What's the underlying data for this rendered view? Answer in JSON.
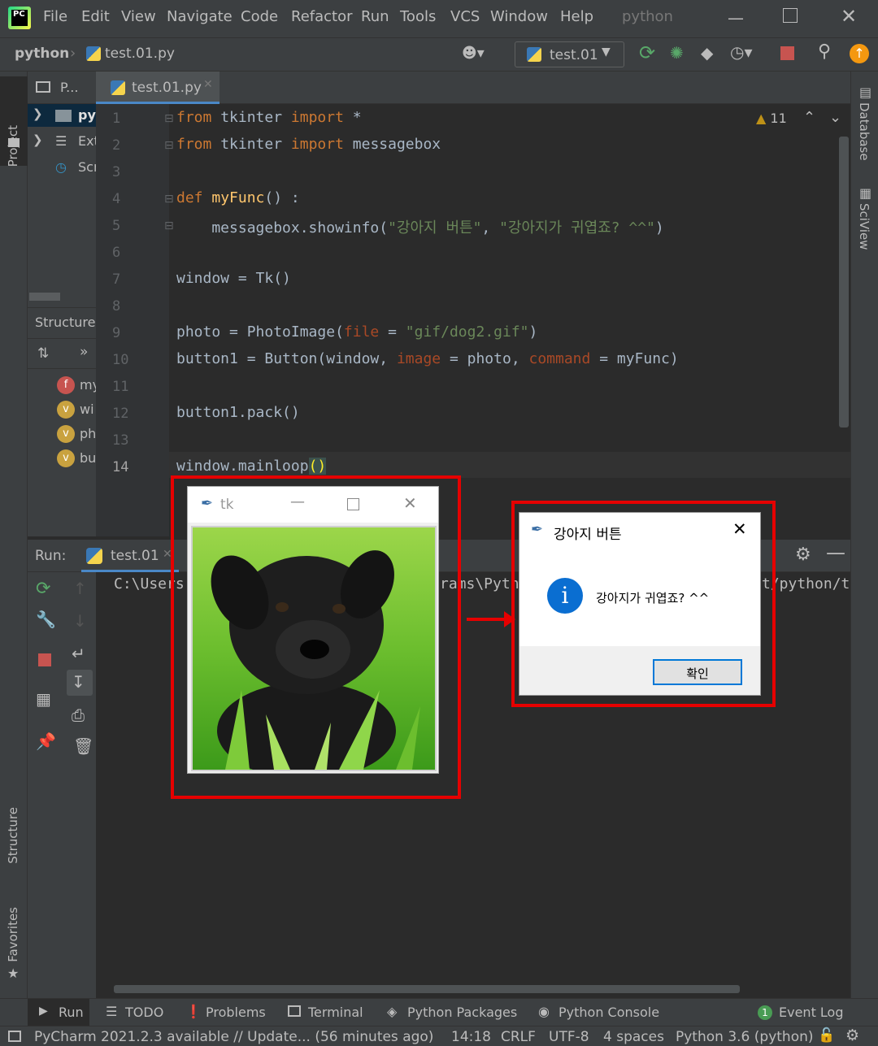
{
  "menubar": {
    "items": [
      "File",
      "Edit",
      "View",
      "Navigate",
      "Code",
      "Refactor",
      "Run",
      "Tools",
      "VCS",
      "Window",
      "Help"
    ],
    "project_title": "python"
  },
  "navbar": {
    "breadcrumb_project": "python",
    "breadcrumb_file": "test.01.py",
    "run_config": "test.01"
  },
  "tool_stripes": {
    "left_top": "Project",
    "left_structure": "Structure",
    "left_favorites": "Favorites",
    "right_database": "Database",
    "right_sciview": "SciView"
  },
  "project_panel": {
    "header": "P...",
    "items": [
      "py",
      "Ext",
      "Scr"
    ]
  },
  "structure_panel": {
    "title": "Structure",
    "items": [
      {
        "badge": "f",
        "label": "my"
      },
      {
        "badge": "v",
        "label": "wi"
      },
      {
        "badge": "v",
        "label": "ph"
      },
      {
        "badge": "v",
        "label": "bu"
      }
    ]
  },
  "editor": {
    "tab_label": "test.01.py",
    "warnings_count": "11",
    "line_numbers": [
      "1",
      "2",
      "3",
      "4",
      "5",
      "6",
      "7",
      "8",
      "9",
      "10",
      "11",
      "12",
      "13",
      "14"
    ],
    "lines": [
      "from tkinter import *",
      "from tkinter import messagebox",
      "",
      "def myFunc() :",
      "    messagebox.showinfo(\"강아지 버튼\", \"강아지가 귀엽죠? ^^\")",
      "",
      "window = Tk()",
      "",
      "photo = PhotoImage(file = \"gif/dog2.gif\")",
      "button1 = Button(window, image = photo, command = myFunc)",
      "",
      "button1.pack()",
      "",
      "window.mainloop()"
    ]
  },
  "run_panel": {
    "label": "Run:",
    "tab_label": "test.01",
    "console_left": "C:\\Users",
    "console_mid": "rams\\Pyth",
    "console_right": "t/python/t"
  },
  "tk_window": {
    "title": "tk"
  },
  "dialog": {
    "title": "강아지 버튼",
    "message": "강아지가 귀엽죠? ^^",
    "ok_label": "확인"
  },
  "bottom_tabs": [
    "Run",
    "TODO",
    "Problems",
    "Terminal",
    "Python Packages",
    "Python Console",
    "Event Log"
  ],
  "event_log_count": "1",
  "statusbar": {
    "message": "PyCharm 2021.2.3 available // Update... (56 minutes ago)",
    "position": "14:18",
    "line_sep": "CRLF",
    "encoding": "UTF-8",
    "indent": "4 spaces",
    "interpreter": "Python 3.6 (python)"
  },
  "colors": {
    "ide_bg": "#2b2b2b",
    "panel_bg": "#3c3f41",
    "keyword": "#cc7832",
    "function": "#ffc66d",
    "string": "#6a8759",
    "highlight_box": "#e60000",
    "info_icon": "#0a6ed1"
  }
}
